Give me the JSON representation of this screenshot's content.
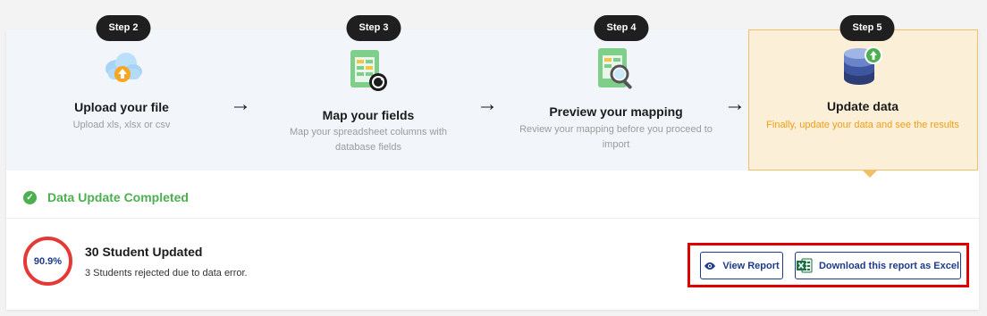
{
  "steps": [
    {
      "badge": "Step 2",
      "title": "Upload your file",
      "desc": "Upload xls, xlsx or csv",
      "icon": "cloud-upload-icon"
    },
    {
      "badge": "Step 3",
      "title": "Map your fields",
      "desc": "Map your spreadsheet columns with database fields",
      "icon": "spreadsheet-sync-icon"
    },
    {
      "badge": "Step 4",
      "title": "Preview your mapping",
      "desc": "Review your mapping before you proceed to import",
      "icon": "document-search-icon"
    },
    {
      "badge": "Step 5",
      "title": "Update data",
      "desc": "Finally, update your data and see the results",
      "icon": "database-upload-icon",
      "active": true
    }
  ],
  "status": {
    "text": "Data Update Completed",
    "icon": "check-circle-icon",
    "color": "#4caf50"
  },
  "result": {
    "percent": "90.9%",
    "title": "30 Student Updated",
    "subtitle": "3 Students rejected due to data error."
  },
  "actions": {
    "view_report": "View Report",
    "download_excel": "Download this report as Excel"
  },
  "colors": {
    "accent": "#1d3b8a",
    "active_bg": "#fcefd8",
    "active_border": "#f0c068",
    "active_text": "#f39c12",
    "ring": "#e53935",
    "highlight": "#e00000"
  }
}
